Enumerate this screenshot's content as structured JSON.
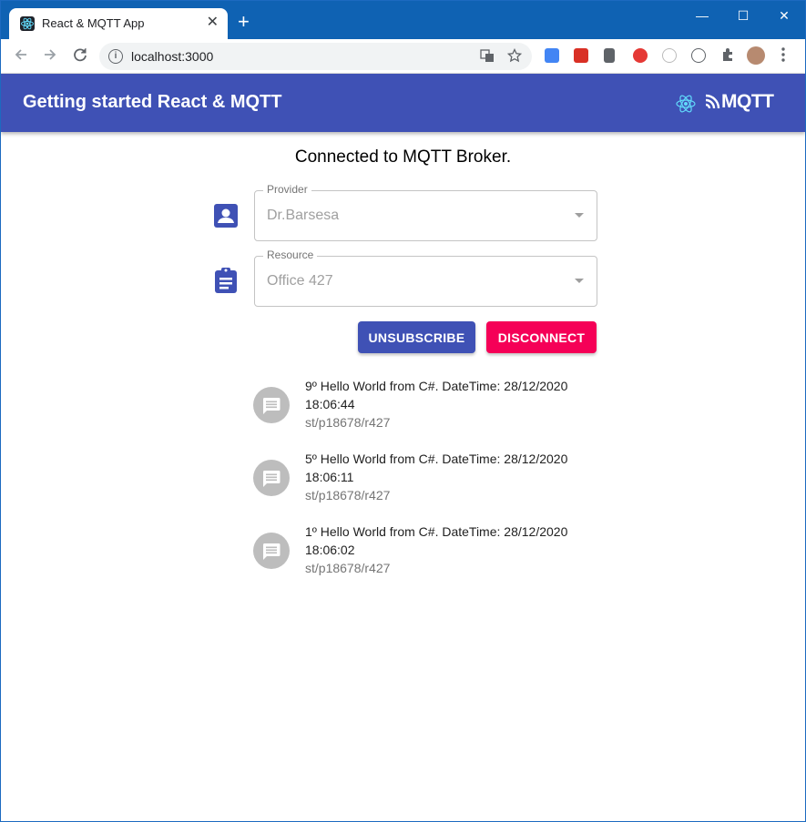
{
  "browser": {
    "tab_title": "React & MQTT App",
    "tab_close": "✕",
    "new_tab": "+",
    "minimize": "—",
    "maximize": "☐",
    "close": "✕",
    "url": "localhost:3000"
  },
  "app": {
    "title": "Getting started React & MQTT",
    "logo_text": "MQTT"
  },
  "status": "Connected to MQTT Broker.",
  "form": {
    "provider": {
      "label": "Provider",
      "value": "Dr.Barsesa"
    },
    "resource": {
      "label": "Resource",
      "value": "Office 427"
    }
  },
  "buttons": {
    "unsubscribe": "UNSUBSCRIBE",
    "disconnect": "DISCONNECT"
  },
  "messages": [
    {
      "text": "9º Hello World from C#. DateTime: 28/12/2020 18:06:44",
      "topic": "st/p18678/r427"
    },
    {
      "text": "5º Hello World from C#. DateTime: 28/12/2020 18:06:11",
      "topic": "st/p18678/r427"
    },
    {
      "text": "1º Hello World from C#. DateTime: 28/12/2020 18:06:02",
      "topic": "st/p18678/r427"
    }
  ],
  "colors": {
    "primary": "#3f51b5",
    "secondary": "#f50057",
    "titlebar": "#0f62b3"
  }
}
